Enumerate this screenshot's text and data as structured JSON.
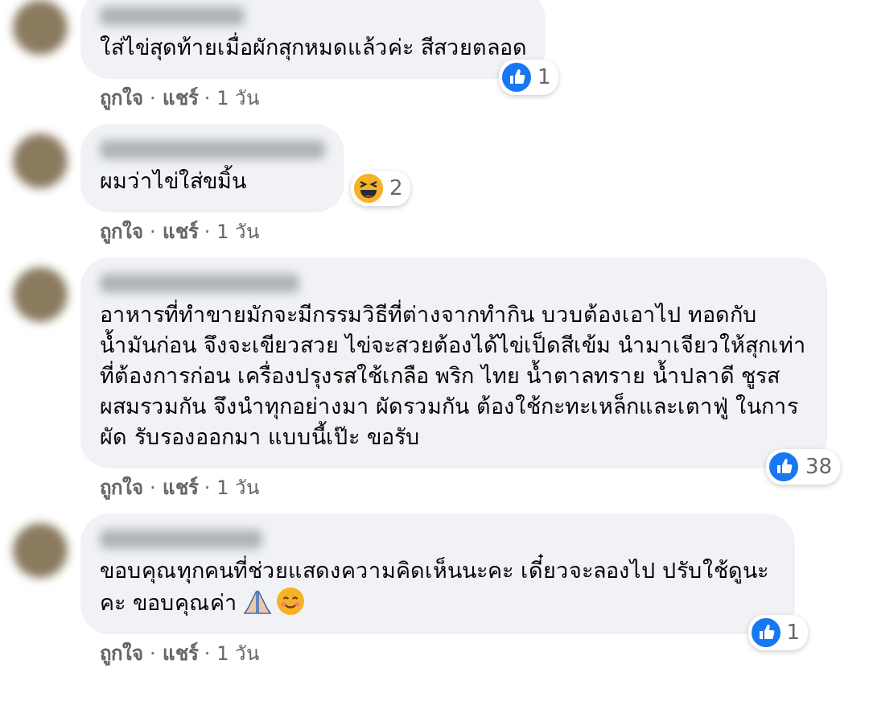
{
  "comments": [
    {
      "text": "ใส่ไข่สุดท้ายเมื่อผักสุกหมดแล้วค่ะ สีสวยตลอด",
      "reaction": {
        "kind": "like",
        "count": "1"
      },
      "actions": [
        "ถูกใจ",
        "แชร์",
        "1 วัน"
      ]
    },
    {
      "text": "ผมว่าไข่ใส่ขมิ้น",
      "reaction": {
        "kind": "haha",
        "count": "2"
      },
      "actions": [
        "ถูกใจ",
        "แชร์",
        "1 วัน"
      ]
    },
    {
      "text": "อาหารที่ทำขายมักจะมีกรรมวิธีที่ต่างจากทำกิน บวบต้องเอาไป ทอดกับน้ำมันก่อน จึงจะเขียวสวย ไข่จะสวยต้องได้ไข่เป็ดสีเข้ม นำมาเจียวให้สุกเท่าที่ต้องการก่อน เครื่องปรุงรสใช้เกลือ พริก ไทย น้ำตาลทราย น้ำปลาดี ชูรส ผสมรวมกัน จึงนำทุกอย่างมา ผัดรวมกัน ต้องใช้กะทะเหล็กและเตาฟู่ ในการผัด รับรองออกมา แบบนี้เป๊ะ ขอรับ",
      "reaction": {
        "kind": "like",
        "count": "38"
      },
      "actions": [
        "ถูกใจ",
        "แชร์",
        "1 วัน"
      ]
    },
    {
      "text": "ขอบคุณทุกคนที่ช่วยแสดงความคิดเห็นนะคะ เดี๋ยวจะลองไป ปรับใช้ดูนะคะ ขอบคุณค่า",
      "emojis": [
        {
          "kind": "pray"
        },
        {
          "kind": "smile"
        }
      ],
      "reaction": {
        "kind": "like",
        "count": "1"
      },
      "actions": [
        "ถูกใจ",
        "แชร์",
        "1 วัน"
      ]
    }
  ],
  "action_separator": "·"
}
